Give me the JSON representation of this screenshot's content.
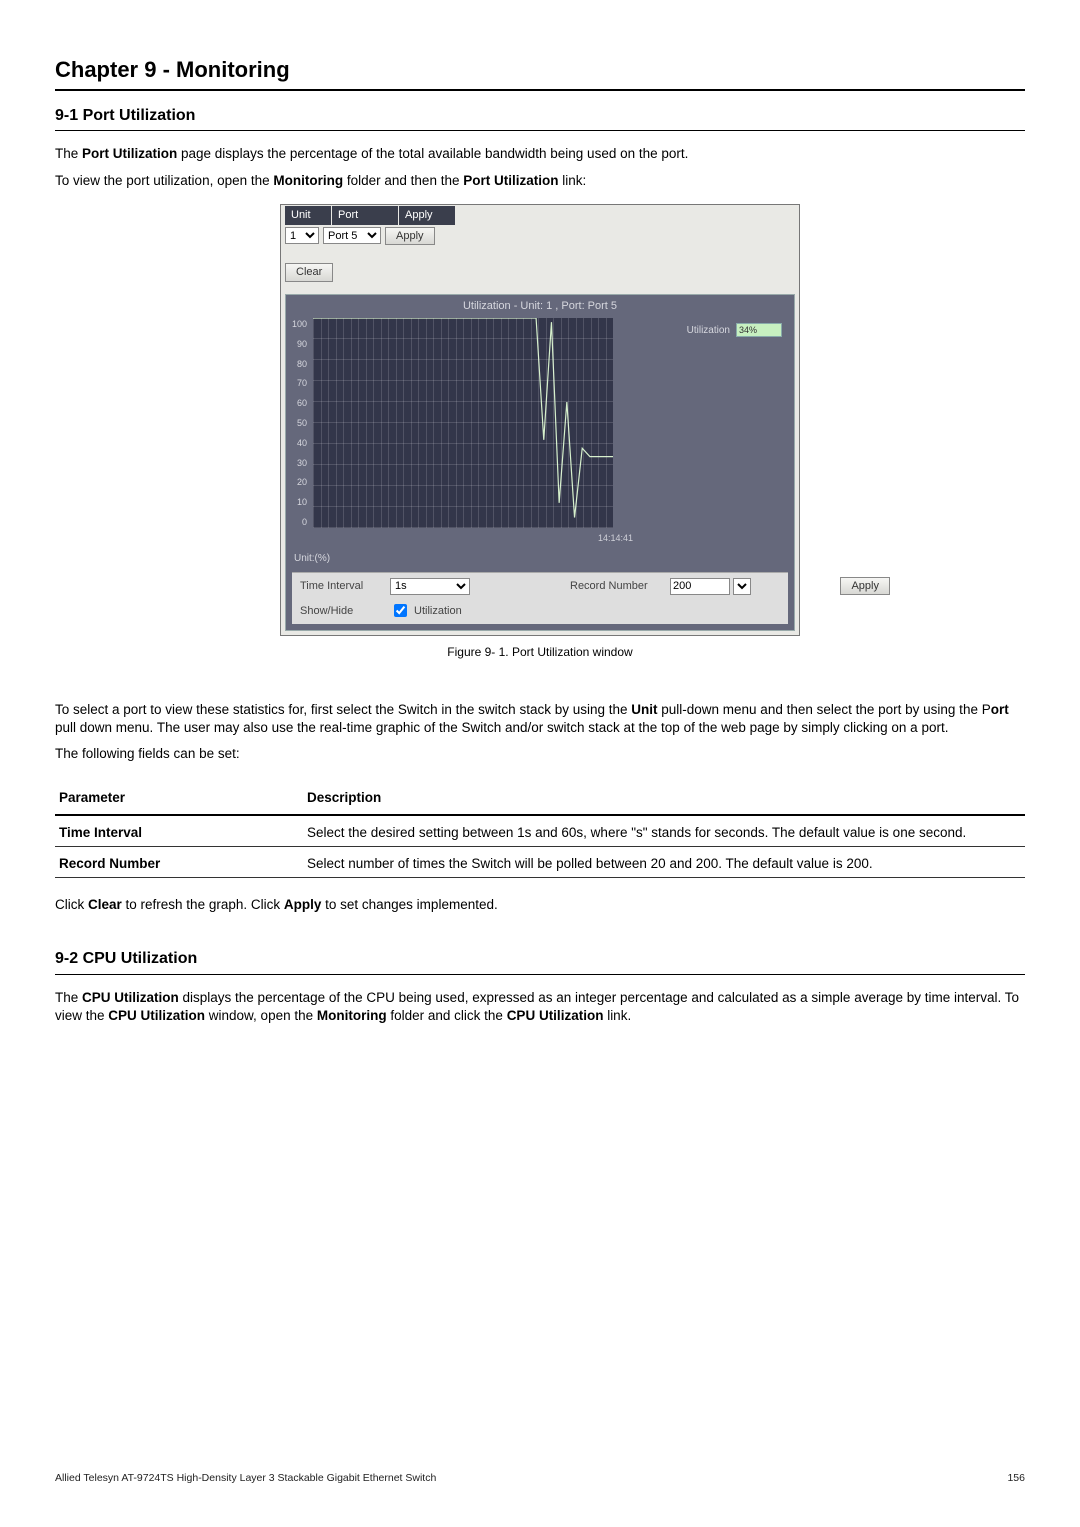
{
  "chapter_title": "Chapter 9 - Monitoring",
  "section_9_1": {
    "heading": "9-1 Port Utilization",
    "p1_pre": "The ",
    "p1_b": "Port Utilization",
    "p1_post": " page displays the percentage of the total available bandwidth being used on the port.",
    "p2_pre": "To view the port utilization, open the ",
    "p2_b1": "Monitoring",
    "p2_mid": " folder and then the ",
    "p2_b2": "Port Utilization",
    "p2_post": " link:"
  },
  "figure": {
    "header": {
      "unit": "Unit",
      "port": "Port",
      "apply": "Apply"
    },
    "controls": {
      "unit_value": "1",
      "port_value": "Port 5",
      "apply_label": "Apply",
      "clear_label": "Clear"
    },
    "chart": {
      "title": "Utilization - Unit: 1 , Port: Port 5",
      "unit_label": "Unit:(%)",
      "xtick": "14:14:41",
      "legend_label": "Utilization",
      "legend_value": "34%"
    },
    "bottom": {
      "time_interval_label": "Time Interval",
      "time_interval_value": "1s",
      "record_number_label": "Record Number",
      "record_number_value": "200",
      "apply_label": "Apply",
      "showhide_label": "Show/Hide",
      "utilization_cb_label": "Utilization"
    },
    "caption": "Figure 9- 1. Port Utilization window"
  },
  "mid_text": {
    "p1_pre": "To select a port to view these statistics for, first select the Switch in the switch stack by using the ",
    "p1_b1": "Unit",
    "p1_mid1": " pull-down menu and then select the port by using the P",
    "p1_b2": "ort",
    "p1_post": " pull down menu. The user may also use the real-time graphic of the Switch and/or switch stack at the top of the web page by simply clicking on a port.",
    "p2": "The following fields can be set:"
  },
  "params": {
    "h_param": "Parameter",
    "h_desc": "Description",
    "row1_param": "Time Interval",
    "row1_desc": "Select the desired setting between 1s and 60s, where \"s\" stands for seconds. The default value is one second.",
    "row2_param": "Record Number",
    "row2_desc": "Select number of times the Switch will be polled between 20 and 200. The default value is 200."
  },
  "after_table": {
    "pre": "Click ",
    "b1": "Clear",
    "mid": " to refresh the graph. Click ",
    "b2": "Apply",
    "post": " to set changes implemented."
  },
  "section_9_2": {
    "heading": "9-2 CPU Utilization",
    "p1_pre": "The ",
    "p1_b1": "CPU Utilization",
    "p1_mid1": " displays the percentage of the CPU being used, expressed as an integer percentage and calculated as a simple average by time interval. To view the ",
    "p1_b2": "CPU Utilization",
    "p1_mid2": " window, open the ",
    "p1_b3": "Monitoring",
    "p1_mid3": " folder and click the ",
    "p1_b4": "CPU Utilization",
    "p1_post": " link."
  },
  "footer": {
    "left": "Allied Telesyn AT-9724TS High-Density Layer 3 Stackable Gigabit Ethernet Switch",
    "right": "156"
  },
  "chart_data": {
    "type": "line",
    "title": "Utilization - Unit: 1 , Port: Port 5",
    "ylabel": "Unit:(%)",
    "ylim": [
      0,
      100
    ],
    "yticks": [
      0,
      10,
      20,
      30,
      40,
      50,
      60,
      70,
      80,
      90,
      100
    ],
    "xnote": "time-series, most recent tick label 14:14:41",
    "series": [
      {
        "name": "Utilization",
        "current_value": 34,
        "values": [
          100,
          100,
          100,
          100,
          100,
          100,
          100,
          100,
          100,
          100,
          100,
          100,
          100,
          100,
          100,
          100,
          100,
          100,
          100,
          100,
          100,
          100,
          100,
          100,
          100,
          100,
          100,
          100,
          100,
          100,
          42,
          98,
          12,
          60,
          5,
          38,
          34,
          34,
          34,
          34
        ]
      }
    ]
  }
}
